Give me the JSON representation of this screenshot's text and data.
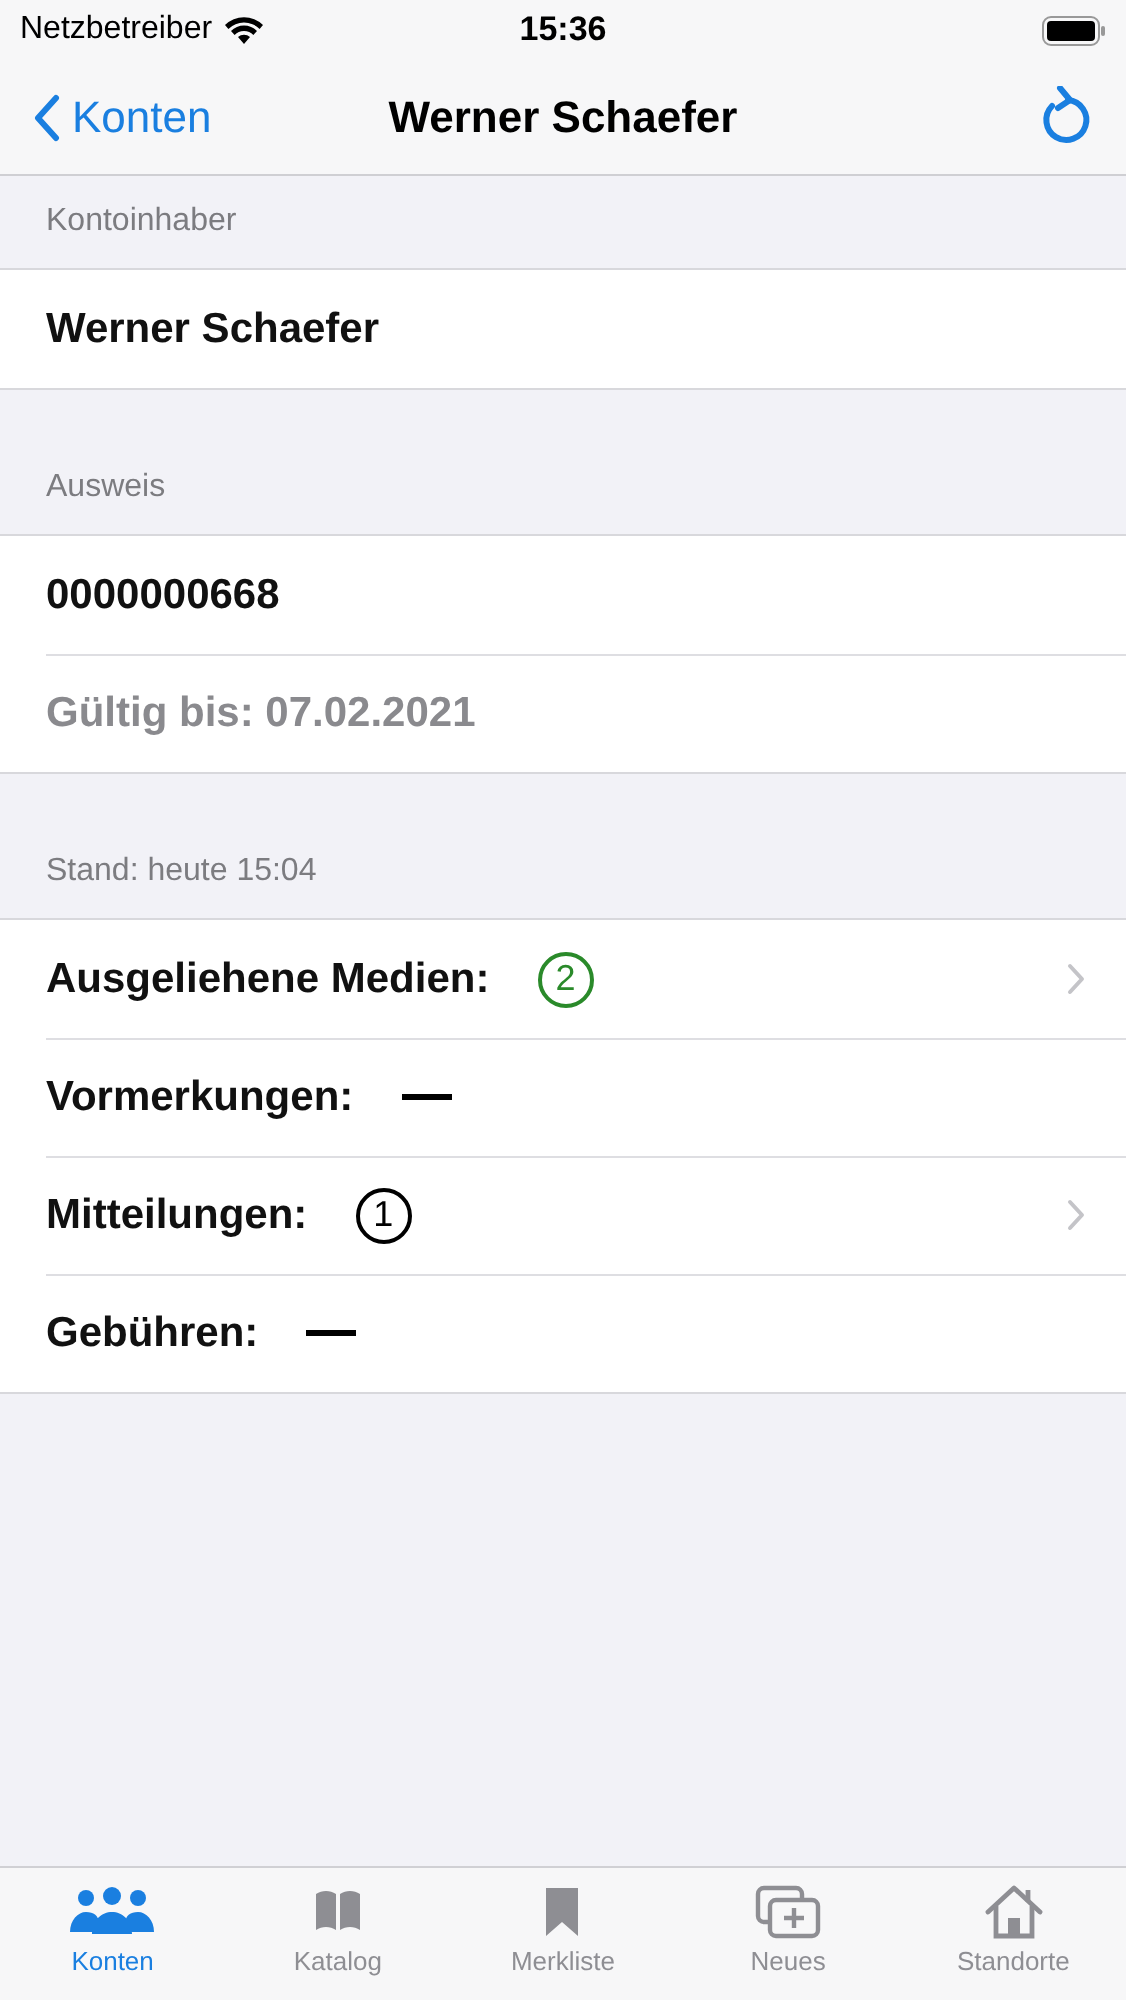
{
  "status_bar": {
    "carrier": "Netzbetreiber",
    "time": "15:36"
  },
  "nav": {
    "back": "Konten",
    "title": "Werner Schaefer"
  },
  "sections": [
    {
      "header": "Kontoinhaber",
      "rows": [
        {
          "kind": "plain",
          "label": "Werner Schaefer"
        }
      ]
    },
    {
      "header": "Ausweis",
      "rows": [
        {
          "kind": "plain",
          "label": "0000000668"
        },
        {
          "kind": "muted",
          "label": "Gültig bis:  07.02.2021"
        }
      ]
    },
    {
      "header": "Stand: heute 15:04",
      "rows": [
        {
          "kind": "badge",
          "label": "Ausgeliehene Medien:",
          "value": "2",
          "color": "#2a8a2a",
          "disclosure": true
        },
        {
          "kind": "dash",
          "label": "Vormerkungen:",
          "disclosure": false
        },
        {
          "kind": "badge",
          "label": "Mitteilungen:",
          "value": "1",
          "color": "#000000",
          "disclosure": true
        },
        {
          "kind": "dash",
          "label": "Gebühren:",
          "disclosure": false
        }
      ]
    }
  ],
  "tabs": [
    {
      "kind": "people",
      "label": "Konten",
      "selected": true
    },
    {
      "kind": "book",
      "label": "Katalog",
      "selected": false
    },
    {
      "kind": "bookmark",
      "label": "Merkliste",
      "selected": false
    },
    {
      "kind": "new",
      "label": "Neues",
      "selected": false
    },
    {
      "kind": "house",
      "label": "Standorte",
      "selected": false
    }
  ]
}
